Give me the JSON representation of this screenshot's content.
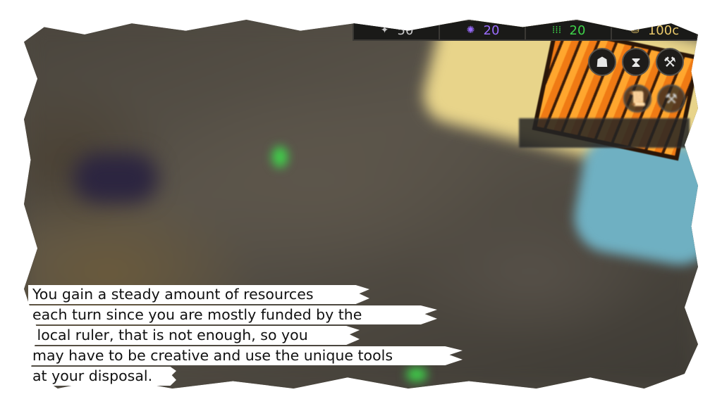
{
  "resources": {
    "scrolls": {
      "value": "50",
      "icon": "scroll-icon",
      "color": "#c9c9c9"
    },
    "mana": {
      "value": "20",
      "icon": "mana-icon",
      "color": "#9a6cff"
    },
    "followers": {
      "value": "20",
      "icon": "followers-icon",
      "color": "#3fd34a"
    },
    "gold": {
      "value": "100c",
      "icon": "gold-pile-icon",
      "color": "#e9c86a"
    }
  },
  "actions": [
    {
      "icon": "hooded-figure-icon",
      "glyph": "☗"
    },
    {
      "icon": "hourglass-icon",
      "glyph": "⧗"
    },
    {
      "icon": "hammer-icon",
      "glyph": "⚒"
    },
    {
      "icon": "scroll-icon",
      "glyph": "📜"
    },
    {
      "icon": "tool-icon",
      "glyph": "⚒"
    }
  ],
  "tutorial": {
    "lines": [
      "You gain a steady amount of resources",
      "each turn since you are mostly funded by the",
      " local ruler, that is not enough, so you",
      "may have to be creative and use the unique tools",
      "at your disposal."
    ]
  }
}
